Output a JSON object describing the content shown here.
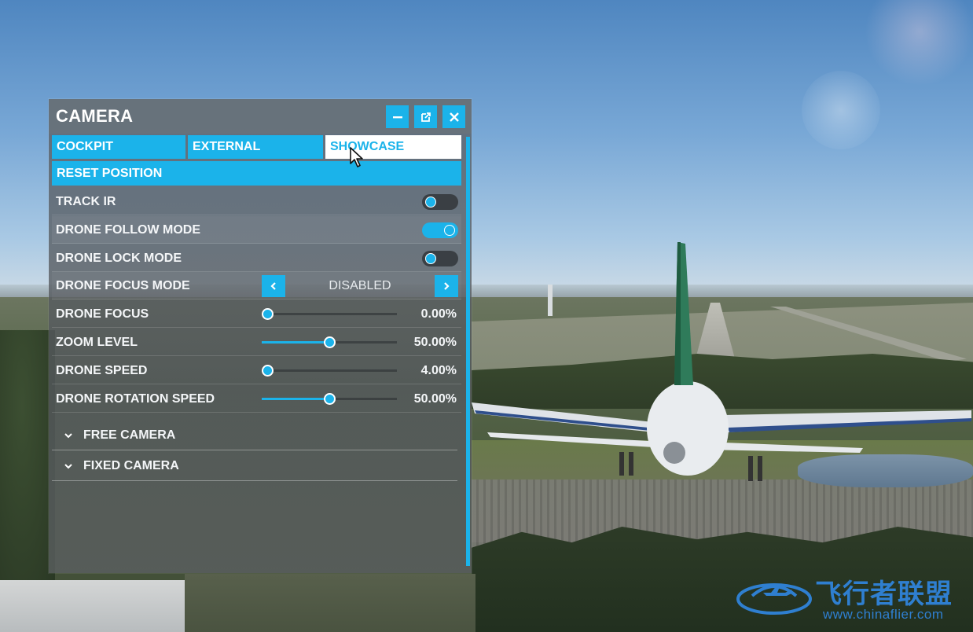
{
  "panel": {
    "title": "CAMERA",
    "header_buttons": [
      "minimize-icon",
      "popout-icon",
      "close-icon"
    ]
  },
  "tabs": [
    {
      "label": "COCKPIT",
      "active": false
    },
    {
      "label": "EXTERNAL",
      "active": false
    },
    {
      "label": "SHOWCASE",
      "active": true
    }
  ],
  "reset_position": {
    "label": "RESET POSITION"
  },
  "settings": {
    "track_ir": {
      "label": "TRACK IR",
      "enabled": false
    },
    "drone_follow_mode": {
      "label": "DRONE FOLLOW MODE",
      "enabled": true
    },
    "drone_lock_mode": {
      "label": "DRONE LOCK MODE",
      "enabled": false
    },
    "drone_focus_mode": {
      "label": "DRONE FOCUS MODE",
      "value": "DISABLED"
    },
    "drone_focus": {
      "label": "DRONE FOCUS",
      "value": "0.00%",
      "level": 0.0
    },
    "zoom_level": {
      "label": "ZOOM LEVEL",
      "value": "50.00%",
      "level": 0.5
    },
    "drone_speed": {
      "label": "DRONE SPEED",
      "value": "4.00%",
      "level": 0.04
    },
    "drone_rotation_speed": {
      "label": "DRONE ROTATION SPEED",
      "value": "50.00%",
      "level": 0.5
    }
  },
  "sections": [
    {
      "label": "FREE CAMERA",
      "icon": "chevron-down-icon"
    },
    {
      "label": "FIXED CAMERA",
      "icon": "chevron-down-icon"
    }
  ],
  "watermark": {
    "title": "飞行者联盟",
    "url": "www.chinaflier.com"
  },
  "colors": {
    "accent": "#1bb3ea",
    "text": "#ffffff",
    "watermark": "#2f7fd0"
  }
}
